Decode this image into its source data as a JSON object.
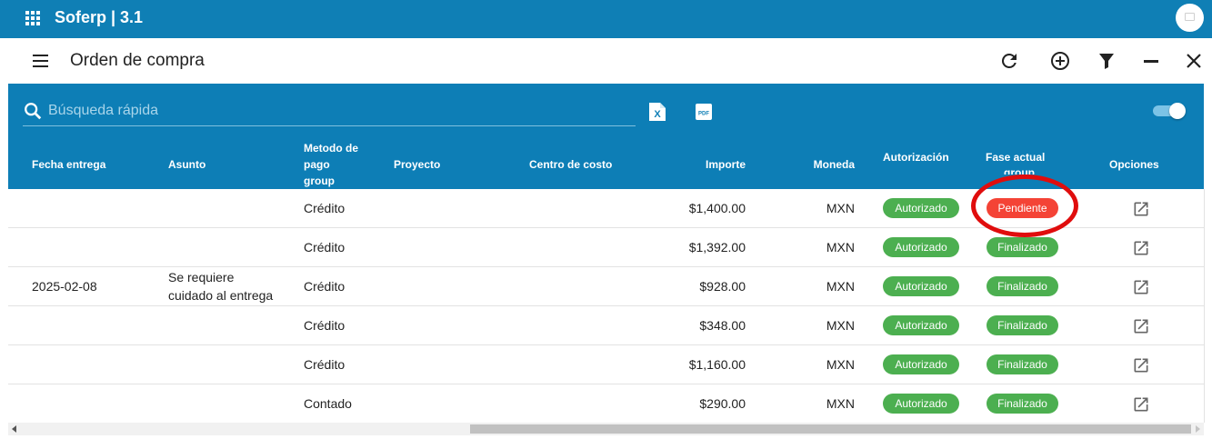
{
  "app": {
    "title": "Soferp | 3.1"
  },
  "page": {
    "title": "Orden de compra"
  },
  "search": {
    "placeholder": "Búsqueda rápida",
    "value": ""
  },
  "export": {
    "excel": "X",
    "pdf": "PDF"
  },
  "columns": {
    "fecha": "Fecha entrega",
    "asunto": "Asunto",
    "metodo_1": "Metodo de",
    "metodo_2": "pago",
    "metodo_3": "group",
    "proyecto": "Proyecto",
    "centro": "Centro de costo",
    "importe": "Importe",
    "moneda": "Moneda",
    "autorizacion": "Autorización",
    "fase_1": "Fase actual",
    "fase_2": "group",
    "opciones": "Opciones"
  },
  "rows": [
    {
      "fecha": "",
      "asunto_1": "",
      "asunto_2": "",
      "metodo": "Crédito",
      "proyecto": "",
      "centro": "",
      "importe": "$1,400.00",
      "moneda": "MXN",
      "autorizacion": "Autorizado",
      "fase": "Pendiente"
    },
    {
      "fecha": "",
      "asunto_1": "",
      "asunto_2": "",
      "metodo": "Crédito",
      "proyecto": "",
      "centro": "",
      "importe": "$1,392.00",
      "moneda": "MXN",
      "autorizacion": "Autorizado",
      "fase": "Finalizado"
    },
    {
      "fecha": "2025-02-08",
      "asunto_1": "Se requiere",
      "asunto_2": "cuidado al entrega",
      "metodo": "Crédito",
      "proyecto": "",
      "centro": "",
      "importe": "$928.00",
      "moneda": "MXN",
      "autorizacion": "Autorizado",
      "fase": "Finalizado"
    },
    {
      "fecha": "",
      "asunto_1": "",
      "asunto_2": "",
      "metodo": "Crédito",
      "proyecto": "",
      "centro": "",
      "importe": "$348.00",
      "moneda": "MXN",
      "autorizacion": "Autorizado",
      "fase": "Finalizado"
    },
    {
      "fecha": "",
      "asunto_1": "",
      "asunto_2": "",
      "metodo": "Crédito",
      "proyecto": "",
      "centro": "",
      "importe": "$1,160.00",
      "moneda": "MXN",
      "autorizacion": "Autorizado",
      "fase": "Finalizado"
    },
    {
      "fecha": "",
      "asunto_1": "",
      "asunto_2": "",
      "metodo": "Contado",
      "proyecto": "",
      "centro": "",
      "importe": "$290.00",
      "moneda": "MXN",
      "autorizacion": "Autorizado",
      "fase": "Finalizado"
    }
  ],
  "colors": {
    "brand": "#0f7fb5",
    "header_panel": "#0d7eb6",
    "badge_green": "#4caf50",
    "badge_red": "#f44336",
    "annotation": "#e00d0d"
  },
  "icons": {
    "apps": "apps-grid-icon",
    "menu": "hamburger-menu-icon",
    "refresh": "refresh-icon",
    "add": "add-circle-icon",
    "filter": "filter-icon",
    "minimize": "minimize-icon",
    "close": "close-icon",
    "search": "search-icon",
    "excel": "excel-export-icon",
    "pdf": "pdf-export-icon",
    "open": "open-in-new-icon"
  },
  "toggle": {
    "on": true
  }
}
